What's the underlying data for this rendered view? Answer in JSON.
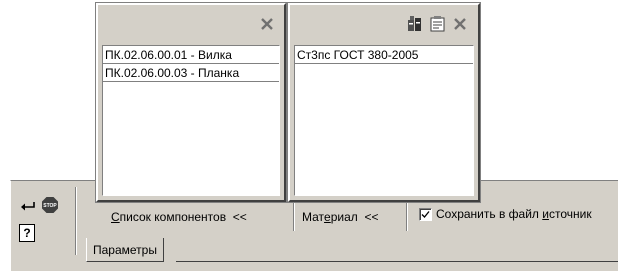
{
  "components_popup": {
    "items": [
      "ПК.02.06.00.01 - Вилка",
      "ПК.02.06.00.03 - Планка"
    ]
  },
  "material_popup": {
    "items": [
      "Ст3пс ГОСТ 380-2005"
    ]
  },
  "panel": {
    "components_button": {
      "underlined": "С",
      "rest": "писок компонентов  <<"
    },
    "material_button": {
      "before": "Мат",
      "underlined": "е",
      "after": "риал  <<"
    },
    "save_checkbox": {
      "checked": true,
      "label_before": "Сохранить в файл ",
      "underlined": "и",
      "label_after": "сточник"
    },
    "tab_label": "Параметры",
    "help_glyph": "?"
  },
  "icons": [
    "enter-arrow-icon",
    "stop-icon",
    "help-icon",
    "close-icon",
    "library-icon",
    "properties-icon"
  ]
}
